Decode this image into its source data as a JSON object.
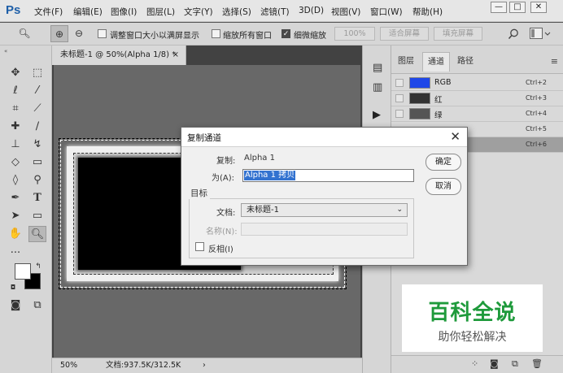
{
  "app": {
    "logo": "Ps"
  },
  "menu": [
    "文件(F)",
    "编辑(E)",
    "图像(I)",
    "图层(L)",
    "文字(Y)",
    "选择(S)",
    "滤镜(T)",
    "3D(D)",
    "视图(V)",
    "窗口(W)",
    "帮助(H)"
  ],
  "window_controls": {
    "minimize": "—",
    "maximize": "□",
    "close": "✕"
  },
  "options_bar": {
    "zoom_tool": "🔍︎",
    "zoom_in": "⊕",
    "zoom_out": "⊖",
    "resize_windows": {
      "label": "调整窗口大小以满屏显示",
      "checked": false
    },
    "zoom_all_windows": {
      "label": "缩放所有窗口",
      "checked": false
    },
    "scrubby_zoom": {
      "label": "细微缩放",
      "checked": true
    },
    "percent_button": "100%",
    "fit_screen_button": "适合屏幕",
    "fill_screen_button": "填充屏幕"
  },
  "document": {
    "tab_title": "未标题-1 @ 50%(Alpha 1/8) *",
    "tab_close": "×",
    "status_zoom": "50%",
    "status_doc": "文档:937.5K/312.5K",
    "status_arrow": "›"
  },
  "channels_panel": {
    "tabs": [
      "图层",
      "通道",
      "路径"
    ],
    "active_tab": "通道",
    "rows": [
      {
        "name": "RGB",
        "shortcut": "Ctrl+2",
        "color": "#1f47e8",
        "selected": false
      },
      {
        "name": "红",
        "shortcut": "Ctrl+3",
        "color": "#333333",
        "selected": false
      },
      {
        "name": "绿",
        "shortcut": "Ctrl+4",
        "color": "#555555",
        "selected": false
      },
      {
        "name": "",
        "shortcut": "Ctrl+5",
        "color": "",
        "selected": false
      },
      {
        "name": "",
        "shortcut": "Ctrl+6",
        "color": "",
        "selected": true
      }
    ]
  },
  "watermark": {
    "line1": "百科全说",
    "line2": "助你轻松解决"
  },
  "dialog": {
    "title": "复制通道",
    "copy_label": "复制:",
    "copy_value": "Alpha 1",
    "as_label": "为(A):",
    "as_value": "Alpha 1 拷贝",
    "ok_button": "确定",
    "cancel_button": "取消",
    "target_group": "目标",
    "document_label": "文档:",
    "document_value": "未标题-1",
    "name_label": "名称(N):",
    "name_value": "",
    "invert_label": "反相(I)",
    "invert_checked": false
  }
}
